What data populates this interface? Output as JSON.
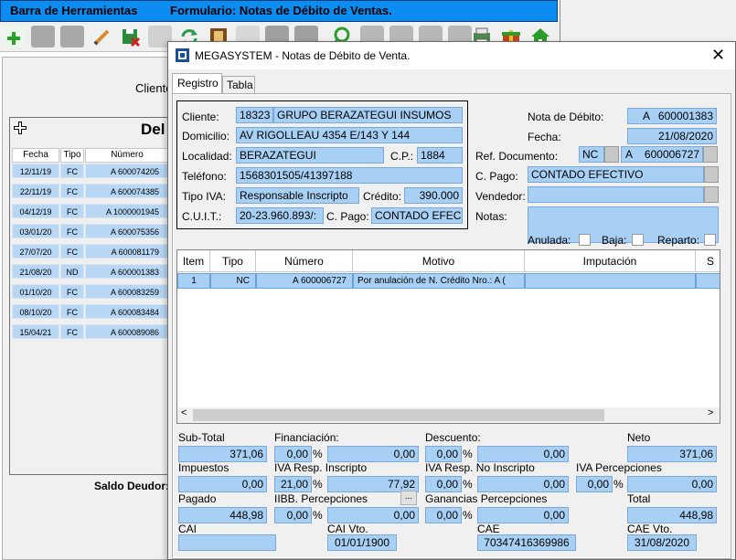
{
  "bg_window": {
    "title_left": "Barra de Herramientas",
    "title_right": "Formulario: Notas de Débito de Ventas.",
    "cliente_label": "Cliente",
    "panel_title": "Del",
    "panel_add_icon": "plus-icon",
    "headers": [
      "Fecha",
      "Tipo",
      "Número"
    ],
    "rows": [
      {
        "fecha": "12/11/19",
        "tipo": "FC",
        "numero": "A  600074205"
      },
      {
        "fecha": "22/11/19",
        "tipo": "FC",
        "numero": "A  600074385"
      },
      {
        "fecha": "04/12/19",
        "tipo": "FC",
        "numero": "A  1000001945"
      },
      {
        "fecha": "03/01/20",
        "tipo": "FC",
        "numero": "A  600075356"
      },
      {
        "fecha": "27/07/20",
        "tipo": "FC",
        "numero": "A  600081179"
      },
      {
        "fecha": "21/08/20",
        "tipo": "ND",
        "numero": "A  600001383"
      },
      {
        "fecha": "01/10/20",
        "tipo": "FC",
        "numero": "A  600083259"
      },
      {
        "fecha": "08/10/20",
        "tipo": "FC",
        "numero": "A  600083484"
      },
      {
        "fecha": "15/04/21",
        "tipo": "FC",
        "numero": "A  600089086"
      }
    ],
    "saldo_label": "Saldo Deudor:"
  },
  "toolbar": {
    "buttons": [
      {
        "icon": "add-icon",
        "color": "#2a9d2a"
      },
      {
        "icon": "save-icon",
        "color": "#9a9a9a"
      },
      {
        "icon": "save-as-icon",
        "color": "#9a9a9a"
      },
      {
        "icon": "edit-icon",
        "color": "#d98a2b"
      },
      {
        "icon": "save-exit-icon",
        "color": "#2a8c3a"
      },
      {
        "icon": "undo-icon",
        "color": "#9a9a9a"
      },
      {
        "icon": "refresh-icon",
        "color": "#2a9d4a"
      },
      {
        "icon": "film-icon",
        "color": "#7a4a1a"
      },
      {
        "icon": "mail-icon",
        "color": "#b0b0b0"
      },
      {
        "icon": "blank-icon",
        "color": "#a0a0a0"
      },
      {
        "icon": "blank-icon",
        "color": "#a0a0a0"
      },
      {
        "icon": "search-icon",
        "color": "#2a9d2a"
      },
      {
        "icon": "first-icon",
        "color": "#a0a0a0"
      },
      {
        "icon": "prev-icon",
        "color": "#a0a0a0"
      },
      {
        "icon": "next-icon",
        "color": "#a0a0a0"
      },
      {
        "icon": "last-icon",
        "color": "#a0a0a0"
      },
      {
        "icon": "print-icon",
        "color": "#4a8a4a"
      },
      {
        "icon": "gift-icon",
        "color": "#c8401a"
      },
      {
        "icon": "home-icon",
        "color": "#2a9d2a"
      }
    ]
  },
  "dialog": {
    "title": "MEGASYSTEM - Notas de Débito de Venta.",
    "tabs": [
      "Registro",
      "Tabla"
    ],
    "cliente_label": "Cliente:",
    "cliente_code": "18323",
    "cliente_name": "GRUPO BERAZATEGUI INSUMOS",
    "domicilio_label": "Domicilio:",
    "domicilio": "AV RIGOLLEAU 4354 E/143 Y 144",
    "localidad_label": "Localidad:",
    "localidad": "BERAZATEGUI",
    "cp_label": "C.P.:",
    "cp": "1884",
    "telefono_label": "Teléfono:",
    "telefono": "1568301505/41397188",
    "tipoiva_label": "Tipo IVA:",
    "tipoiva": "Responsable Inscripto",
    "credito_label": "Crédito:",
    "credito": "390.000",
    "cuit_label": "C.U.I.T.:",
    "cuit": "20-23.960.893/:",
    "cpago_left_label": "C. Pago:",
    "cpago_left": "CONTADO EFEC",
    "nota_label": "Nota de Débito:",
    "nota_letra": "A",
    "nota_numero": "600001383",
    "fecha_label": "Fecha:",
    "fecha": "21/08/2020",
    "refdoc_label": "Ref. Documento:",
    "refdoc_tipo": "NC",
    "refdoc_letra": "A",
    "refdoc_numero": "600006727",
    "cpago_label": "C. Pago:",
    "cpago": "CONTADO EFECTIVO",
    "vendedor_label": "Vendedor:",
    "vendedor": "",
    "notas_label": "Notas:",
    "anulada_label": "Anulada:",
    "baja_label": "Baja:",
    "reparto_label": "Reparto:",
    "grid_headers": [
      "Item",
      "Tipo",
      "Número",
      "Motivo",
      "Imputación",
      "S"
    ],
    "grid_rows": [
      {
        "item": "1",
        "tipo": "NC",
        "numero": "A   600006727",
        "motivo": "Por anulación de N. Crédito Nro.: A  (",
        "imputacion": ""
      }
    ],
    "totals": {
      "subtotal_label": "Sub-Total",
      "subtotal": "371,06",
      "financiacion_label": "Financiación:",
      "financiacion_pct": "0,00",
      "financiacion": "0,00",
      "descuento_label": "Descuento:",
      "descuento_pct": "0,00",
      "descuento": "0,00",
      "neto_label": "Neto",
      "neto": "371,06",
      "impuestos_label": "Impuestos",
      "impuestos": "0,00",
      "iva_ri_label": "IVA Resp. Inscripto",
      "iva_ri_pct": "21,00",
      "iva_ri": "77,92",
      "iva_rni_label": "IVA Resp. No Inscripto",
      "iva_rni_pct": "0,00",
      "iva_rni": "0,00",
      "iva_perc_label": "IVA Percepciones",
      "iva_perc_pct": "0,00",
      "iva_perc": "0,00",
      "pagado_label": "Pagado",
      "pagado": "448,98",
      "iibb_label": "IIBB. Percepciones",
      "iibb_btn": "...",
      "iibb_pct": "0,00",
      "iibb": "0,00",
      "ganancias_label": "Ganancias Percepciones",
      "ganancias_pct": "0,00",
      "ganancias": "0,00",
      "total_label": "Total",
      "total": "448,98",
      "pct": "%",
      "cai_label": "CAI",
      "cai": "",
      "cai_vto_label": "CAI Vto.",
      "cai_vto": "01/01/1900",
      "cae_label": "CAE",
      "cae": "70347416369986",
      "cae_vto_label": "CAE Vto.",
      "cae_vto": "31/08/2020"
    }
  },
  "colors": {
    "field_bg": "#a8d0f5",
    "title_bar": "#0a8cf0"
  }
}
